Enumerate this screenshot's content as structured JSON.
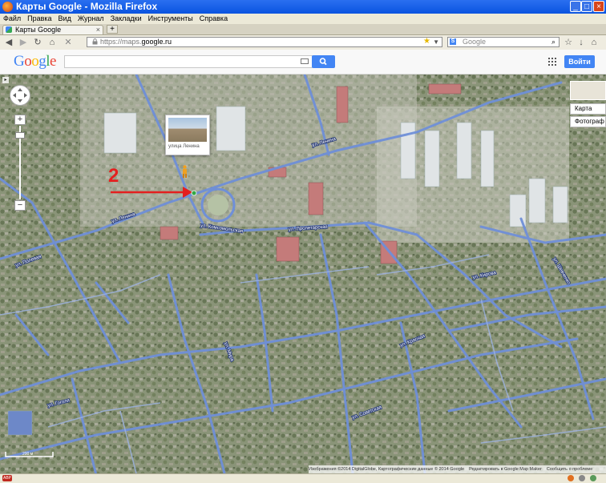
{
  "window": {
    "title": "Карты Google - Mozilla Firefox"
  },
  "menu": {
    "items": [
      "Файл",
      "Правка",
      "Вид",
      "Журнал",
      "Закладки",
      "Инструменты",
      "Справка"
    ]
  },
  "tab": {
    "label": "Карты Google",
    "close": "×",
    "new_tab": "+"
  },
  "nav": {
    "url_host_prefix": "https://maps.",
    "url_host_main": "google.ru",
    "search_engine": "S",
    "search_placeholder": "Google"
  },
  "google": {
    "logo_letters": [
      "G",
      "o",
      "o",
      "g",
      "l",
      "e"
    ],
    "logo_colors": [
      "#4285f4",
      "#ea4335",
      "#fbbc05",
      "#4285f4",
      "#34a853",
      "#ea4335"
    ],
    "signin_label": "Войти"
  },
  "map": {
    "annotation_number": "2",
    "annotation_color": "#e41f1f",
    "road_color": "#6f8fd8",
    "street_view_caption": "улица Ленина",
    "zoom_in": "+",
    "zoom_out": "−",
    "map_type_map": "Карта",
    "map_type_photo": "Фотограф",
    "copyright_parts": [
      "Изображения ©2014 DigitalGlobe, Картографические данные © 2014 Google",
      "Редактировать в Google Map Maker",
      "Сообщить о проблеме"
    ],
    "street_labels": [
      "ул. Ленина",
      "ул. Ленина",
      "ул. Комсомольская",
      "ул. Полевая",
      "ул. Пролетарская",
      "ул. Красная",
      "ул. Мира",
      "ул. Гоголя",
      "ул. Кирова",
      "ул. Советская",
      "ул. Шевченко"
    ],
    "scale_label": "200 м"
  }
}
